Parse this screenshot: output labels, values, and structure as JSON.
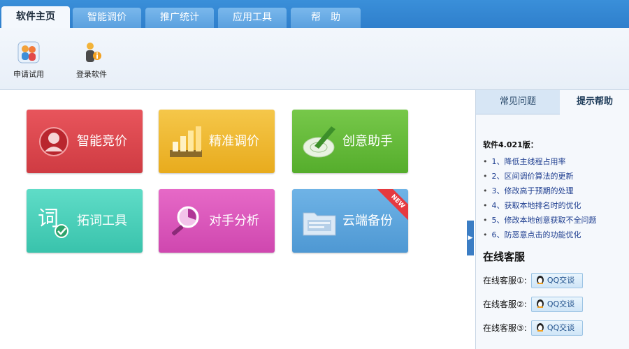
{
  "tabs": [
    {
      "label": "软件主页",
      "active": true
    },
    {
      "label": "智能调价",
      "active": false
    },
    {
      "label": "推广统计",
      "active": false
    },
    {
      "label": "应用工具",
      "active": false
    },
    {
      "label": "帮　助",
      "active": false
    }
  ],
  "toolbar": {
    "apply_trial": {
      "label": "申请试用",
      "icon": "users-icon"
    },
    "login": {
      "label": "登录软件",
      "icon": "user-info-icon"
    }
  },
  "tiles": [
    {
      "label": "智能竞价",
      "icon": "person-icon",
      "color": "#d8464c"
    },
    {
      "label": "精准调价",
      "icon": "bar-chart-icon",
      "color": "#efb830"
    },
    {
      "label": "创意助手",
      "icon": "disc-pen-icon",
      "color": "#66bb3b"
    },
    {
      "label": "拓词工具",
      "icon": "word-check-icon",
      "color": "#4ccfb8"
    },
    {
      "label": "对手分析",
      "icon": "magnifier-icon",
      "color": "#da58bb"
    },
    {
      "label": "云端备份",
      "icon": "folder-icon",
      "color": "#5ea5dd",
      "badge": "NEW"
    }
  ],
  "right_panel": {
    "tabs": [
      "常见问题",
      "提示帮助"
    ],
    "version_title": "软件4.021版：",
    "notes": [
      "1、降低主线程占用率",
      "2、区间调价算法的更新",
      "3、修改高于预期的处理",
      "4、获取本地排名时的优化",
      "5、修改本地创意获取不全问题",
      "6、防恶意点击的功能优化"
    ],
    "service_title": "在线客服",
    "services": [
      {
        "label": "在线客服①:",
        "button": "QQ交谈"
      },
      {
        "label": "在线客服②:",
        "button": "QQ交谈"
      },
      {
        "label": "在线客服③:",
        "button": "QQ交谈"
      }
    ]
  },
  "colors": {
    "accent": "#2f7fcc",
    "panel_bg": "#f5f8fc"
  }
}
